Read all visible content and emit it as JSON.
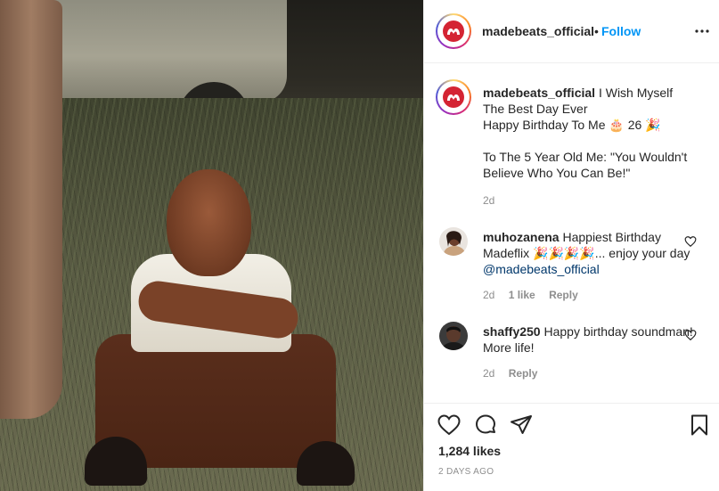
{
  "post": {
    "username": "madebeats_official",
    "separator": "•",
    "follow_label": "Follow",
    "more_icon": "more-horizontal-icon"
  },
  "caption": {
    "username": "madebeats_official",
    "line1": "I Wish Myself The Best Day Ever",
    "line2": "Happy Birthday To Me 🎂 26 🎉",
    "line3": "To The 5 Year Old Me: \"You Wouldn't Believe Who You Can Be!\"",
    "age": "2d"
  },
  "comments": [
    {
      "username": "muhozanena",
      "text": "Happiest Birthday Madeflix 🎉🎉🎉🎉... enjoy your day",
      "mention": "@madebeats_official",
      "age": "2d",
      "likes": "1 like",
      "reply": "Reply"
    },
    {
      "username": "shaffy250",
      "text": "Happy birthday soundman! More life!",
      "age": "2d",
      "reply": "Reply"
    }
  ],
  "footer": {
    "likes": "1,284 likes",
    "timestamp": "2 DAYS AGO"
  },
  "colors": {
    "accent": "#0095f6",
    "text": "#262626",
    "muted": "#8e8e8e",
    "brand_red": "#d42433"
  }
}
